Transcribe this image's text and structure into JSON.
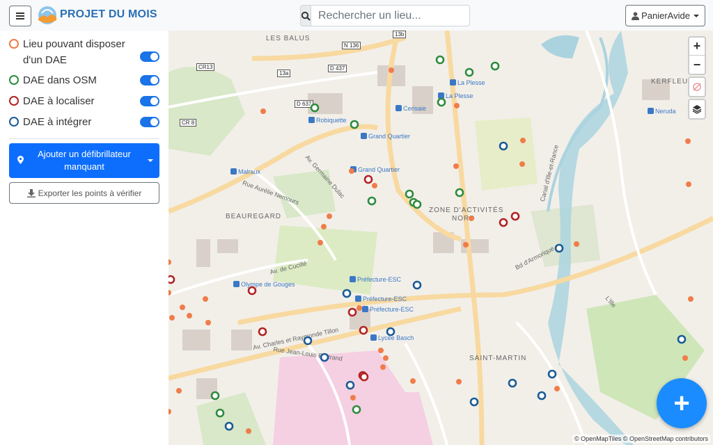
{
  "header": {
    "brand": "PROJET DU MOIS",
    "search_placeholder": "Rechercher un lieu...",
    "cart_label": "PanierAvide"
  },
  "sidebar": {
    "layers": [
      {
        "label": "Lieu pouvant disposer d'un DAE",
        "color": "#f07c4a",
        "enabled": true
      },
      {
        "label": "DAE dans OSM",
        "color": "#2e8b3d",
        "enabled": true
      },
      {
        "label": "DAE à localiser",
        "color": "#b22222",
        "enabled": true
      },
      {
        "label": "DAE à intégrer",
        "color": "#1a5a96",
        "enabled": true
      }
    ],
    "add_button": "Ajouter un défibrillateur manquant",
    "export_button": "Exporter les points à vérifier"
  },
  "map": {
    "zoom_in": "+",
    "zoom_out": "−",
    "attribution": "© OpenMapTiles © OpenStreetMap contributors",
    "districts": [
      "LES BALUS",
      "KERFLEURY",
      "BEAUREGARD",
      "ZONE D'ACTIVITÉS",
      "NORD",
      "SAINT-MARTIN"
    ],
    "roads": [
      "N 136",
      "D 437",
      "D 637",
      "CR13",
      "CR 8",
      "13a",
      "13b",
      "Av. Germaine Dulac",
      "Rue Aurélie Nemours",
      "Av. de Cucillé",
      "Av. Charles et Raymonde Tillon",
      "Rue Jean-Louis Bertrand",
      "Bd d'Armorique",
      "Canal d'Ille-et-Rance",
      "L'Ille"
    ],
    "stops": [
      "La Plesse",
      "La Plesse",
      "Cerisaie",
      "Robiquette",
      "Grand Quartier",
      "Grand Quartier",
      "Malraux",
      "Préfecture-ESC",
      "Préfecture-ESC",
      "Préfecture-ESC",
      "Olympe de Gouges",
      "Lycée Basch",
      "Neruda"
    ]
  },
  "fab_label": "+"
}
